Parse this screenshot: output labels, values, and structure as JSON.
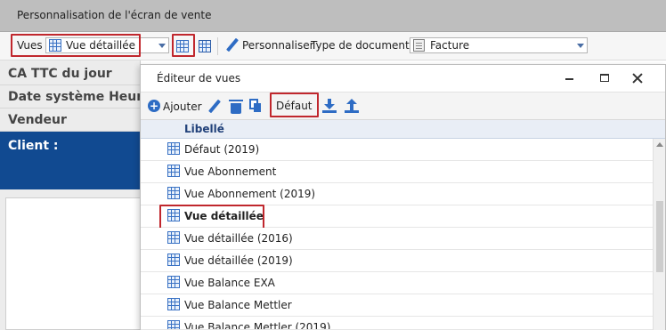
{
  "window": {
    "title": "Personnalisation de l'écran de vente"
  },
  "toolbar": {
    "vues_label": "Vues",
    "vues_value": "Vue détaillée",
    "personnaliser_label": "Personnaliser",
    "type_doc_label": "Type de document",
    "type_doc_value": "Facture"
  },
  "left_panel": {
    "rows": [
      {
        "label": "CA TTC du jour"
      },
      {
        "label": "Date système  Heur"
      },
      {
        "label": "Vendeur"
      },
      {
        "label": "Client :"
      }
    ]
  },
  "dialog": {
    "title": "Éditeur de vues",
    "toolbar": {
      "add_label": "Ajouter",
      "default_label": "Défaut"
    },
    "grid": {
      "column_header": "Libellé",
      "rows": [
        {
          "label": "Défaut (2019)"
        },
        {
          "label": "Vue Abonnement"
        },
        {
          "label": "Vue Abonnement (2019)"
        },
        {
          "label": "Vue détaillée"
        },
        {
          "label": "Vue détaillée (2016)"
        },
        {
          "label": "Vue détaillée (2019)"
        },
        {
          "label": "Vue Balance EXA"
        },
        {
          "label": "Vue Balance Mettler"
        },
        {
          "label": "Vue Balance Mettler (2019)"
        }
      ]
    }
  },
  "colors": {
    "accent": "#2e6cc4",
    "highlight_border": "#c0272d",
    "client_row": "#114a91"
  }
}
